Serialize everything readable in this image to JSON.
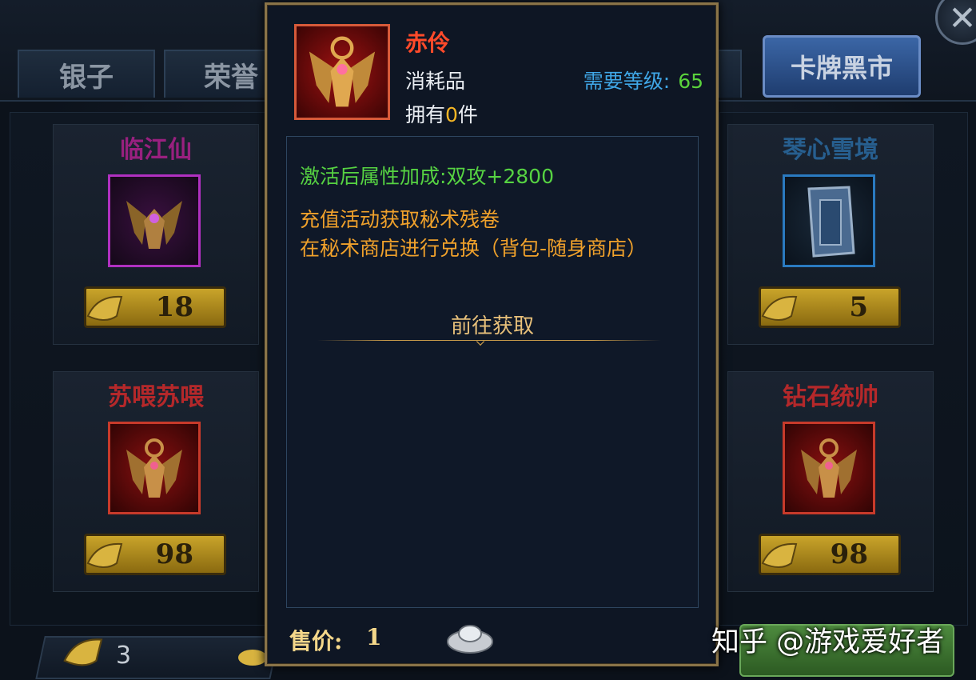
{
  "tabs": {
    "silver": "银子",
    "honor": "荣誉",
    "black_market": "卡牌黑市"
  },
  "cards": {
    "top_left": {
      "name": "临江仙",
      "price": "18",
      "name_color": "#b0208e",
      "frame_color": "#b030c0",
      "icon": "purple-emblem-icon"
    },
    "bottom_left": {
      "name": "苏喂苏喂",
      "price": "98",
      "name_color": "#d02a2a",
      "frame_color": "#c83a2a",
      "icon": "red-emblem-icon"
    },
    "top_right": {
      "name": "琴心雪境",
      "price": "5",
      "name_color": "#2a6aa0",
      "frame_color": "#2a7ac0",
      "icon": "title-scroll-icon"
    },
    "bottom_right": {
      "name": "钻石统帅",
      "price": "98",
      "name_color": "#d02a2a",
      "frame_color": "#c83a2a",
      "icon": "red-emblem-icon"
    }
  },
  "bottom_bar": {
    "scroll_count": "3"
  },
  "popup": {
    "title": "赤伶",
    "type": "消耗品",
    "own_prefix": "拥有",
    "own_count": "0",
    "own_suffix": "件",
    "level_label": "需要等级:",
    "level_value": "65",
    "attribute": "激活后属性加成:双攻+2800",
    "desc_line1": "充值活动获取秘术残卷",
    "desc_line2": "在秘术商店进行兑换（背包-随身商店）",
    "goto_label": "前往获取",
    "price_label": "售价:",
    "price_value": "1"
  },
  "watermark": "知乎 @游戏爱好者"
}
